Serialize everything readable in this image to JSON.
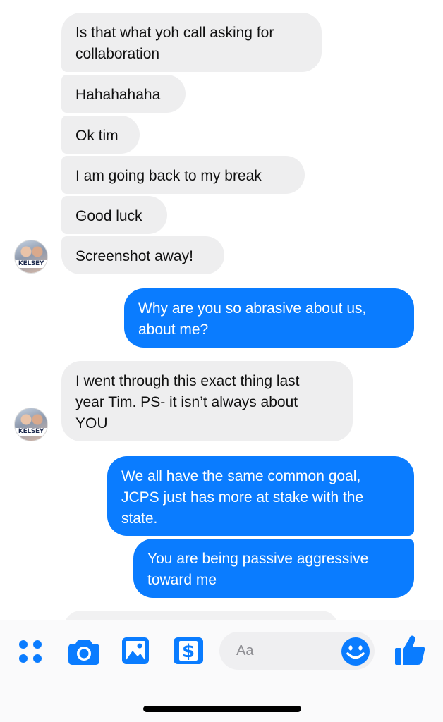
{
  "contact": {
    "avatar_label": "KELSEY"
  },
  "messages": [
    {
      "sender": "contact",
      "text": "Is that what yoh call asking for\ncollaboration"
    },
    {
      "sender": "contact",
      "text": "Hahahahaha"
    },
    {
      "sender": "contact",
      "text": "Ok tim"
    },
    {
      "sender": "contact",
      "text": "I am going back to my break"
    },
    {
      "sender": "contact",
      "text": "Good luck"
    },
    {
      "sender": "contact",
      "text": "Screenshot away!"
    },
    {
      "sender": "me",
      "text": "Why are you so abrasive about us,\nabout me?"
    },
    {
      "sender": "contact",
      "text": "I went through this exact thing last\nyear Tim. PS- it isn’t always about\nYOU"
    },
    {
      "sender": "me",
      "text": "We all have the same common goal,\nJCPS just has more at stake with the\nstate."
    },
    {
      "sender": "me",
      "text": "You are being passive aggressive\ntoward me"
    }
  ],
  "composer": {
    "placeholder": "Aa",
    "icons": [
      "more-dots-icon",
      "camera-icon",
      "gallery-icon",
      "payment-dollar-icon",
      "emoji-icon",
      "thumbs-up-icon"
    ]
  },
  "colors": {
    "incoming_bubble": "#eeeeef",
    "outgoing_bubble": "#0a7cff",
    "accent": "#0a7cff"
  }
}
